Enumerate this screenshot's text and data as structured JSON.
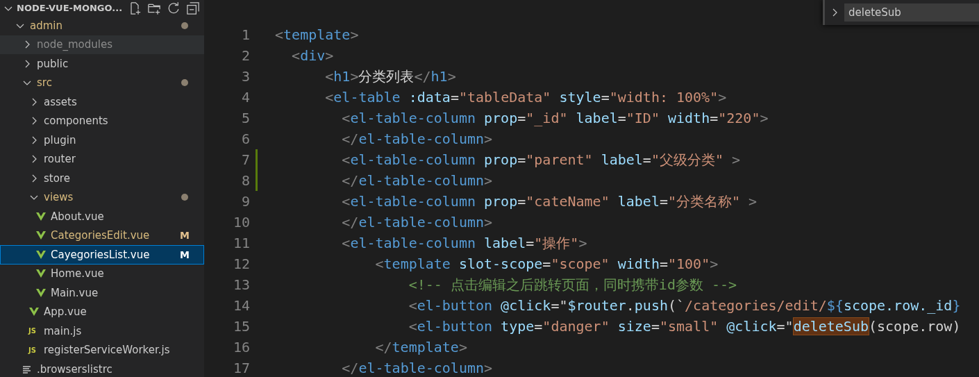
{
  "explorer": {
    "title": "NODE-VUE-MONGO...",
    "expanded": true,
    "tree": [
      {
        "name": "admin",
        "kind": "folder",
        "expanded": true,
        "modified": true,
        "selected": false,
        "children": [
          {
            "name": "node_modules",
            "kind": "folder",
            "expanded": false,
            "ignored": true,
            "selected": false,
            "hovered": true
          },
          {
            "name": "public",
            "kind": "folder",
            "expanded": false,
            "selected": false
          },
          {
            "name": "src",
            "kind": "folder",
            "expanded": true,
            "modified": true,
            "selected": false,
            "children": [
              {
                "name": "assets",
                "kind": "folder",
                "expanded": false,
                "selected": false
              },
              {
                "name": "components",
                "kind": "folder",
                "expanded": false,
                "selected": false
              },
              {
                "name": "plugin",
                "kind": "folder",
                "expanded": false,
                "selected": false
              },
              {
                "name": "router",
                "kind": "folder",
                "expanded": false,
                "selected": false
              },
              {
                "name": "store",
                "kind": "folder",
                "expanded": false,
                "selected": false
              },
              {
                "name": "views",
                "kind": "folder",
                "expanded": true,
                "modified": true,
                "selected": false,
                "children": [
                  {
                    "name": "About.vue",
                    "kind": "vue",
                    "selected": false
                  },
                  {
                    "name": "CategoriesEdit.vue",
                    "kind": "vue",
                    "modified": true,
                    "badge": "M",
                    "selected": false
                  },
                  {
                    "name": "CayegoriesList.vue",
                    "kind": "vue",
                    "modified": true,
                    "badge": "M",
                    "selected": true
                  },
                  {
                    "name": "Home.vue",
                    "kind": "vue",
                    "selected": false
                  },
                  {
                    "name": "Main.vue",
                    "kind": "vue",
                    "selected": false
                  }
                ]
              },
              {
                "name": "App.vue",
                "kind": "vue",
                "selected": false
              },
              {
                "name": "main.js",
                "kind": "js",
                "icon_text": "JS",
                "selected": false
              },
              {
                "name": "registerServiceWorker.js",
                "kind": "js",
                "icon_text": "JS",
                "selected": false
              }
            ]
          },
          {
            "name": ".browserslistrc",
            "kind": "config",
            "selected": false
          }
        ]
      }
    ]
  },
  "find_widget": {
    "value": "deleteSub"
  },
  "editor": {
    "lines": [
      {
        "number": "1",
        "changed": false,
        "tokens": [
          {
            "kind": "punct",
            "t": "<"
          },
          {
            "kind": "tag",
            "t": "template"
          },
          {
            "kind": "punct",
            "t": ">"
          }
        ]
      },
      {
        "number": "2",
        "changed": false,
        "tokens": [
          {
            "kind": "punct",
            "t": "  <"
          },
          {
            "kind": "tag",
            "t": "div"
          },
          {
            "kind": "punct",
            "t": ">"
          }
        ]
      },
      {
        "number": "3",
        "changed": false,
        "tokens": [
          {
            "kind": "punct",
            "t": "      <"
          },
          {
            "kind": "tag",
            "t": "h1"
          },
          {
            "kind": "punct",
            "t": ">"
          },
          {
            "kind": "text",
            "t": "分类列表"
          },
          {
            "kind": "punct",
            "t": "</"
          },
          {
            "kind": "tag",
            "t": "h1"
          },
          {
            "kind": "punct",
            "t": ">"
          }
        ]
      },
      {
        "number": "4",
        "changed": false,
        "tokens": [
          {
            "kind": "punct",
            "t": "      <"
          },
          {
            "kind": "tag",
            "t": "el-table"
          },
          {
            "kind": "attr",
            "t": " :data"
          },
          {
            "kind": "text",
            "t": "="
          },
          {
            "kind": "string",
            "t": "\"tableData\""
          },
          {
            "kind": "attr",
            "t": " style"
          },
          {
            "kind": "text",
            "t": "="
          },
          {
            "kind": "string",
            "t": "\"width: 100%\""
          },
          {
            "kind": "punct",
            "t": ">"
          }
        ]
      },
      {
        "number": "5",
        "changed": false,
        "tokens": [
          {
            "kind": "punct",
            "t": "        <"
          },
          {
            "kind": "tag",
            "t": "el-table-column"
          },
          {
            "kind": "attr",
            "t": " prop"
          },
          {
            "kind": "text",
            "t": "="
          },
          {
            "kind": "string",
            "t": "\"_id\""
          },
          {
            "kind": "attr",
            "t": " label"
          },
          {
            "kind": "text",
            "t": "="
          },
          {
            "kind": "string",
            "t": "\"ID\""
          },
          {
            "kind": "attr",
            "t": " width"
          },
          {
            "kind": "text",
            "t": "="
          },
          {
            "kind": "string",
            "t": "\"220\""
          },
          {
            "kind": "punct",
            "t": ">"
          }
        ]
      },
      {
        "number": "6",
        "changed": false,
        "tokens": [
          {
            "kind": "punct",
            "t": "        </"
          },
          {
            "kind": "tag",
            "t": "el-table-column"
          },
          {
            "kind": "punct",
            "t": ">"
          }
        ]
      },
      {
        "number": "7",
        "changed": true,
        "tokens": [
          {
            "kind": "punct",
            "t": "        <"
          },
          {
            "kind": "tag",
            "t": "el-table-column"
          },
          {
            "kind": "attr",
            "t": " prop"
          },
          {
            "kind": "text",
            "t": "="
          },
          {
            "kind": "string",
            "t": "\"parent\""
          },
          {
            "kind": "attr",
            "t": " label"
          },
          {
            "kind": "text",
            "t": "="
          },
          {
            "kind": "string",
            "t": "\"父级分类\""
          },
          {
            "kind": "punct",
            "t": " >"
          }
        ]
      },
      {
        "number": "8",
        "changed": true,
        "tokens": [
          {
            "kind": "punct",
            "t": "        </"
          },
          {
            "kind": "tag",
            "t": "el-table-column"
          },
          {
            "kind": "punct",
            "t": ">"
          }
        ]
      },
      {
        "number": "9",
        "changed": false,
        "tokens": [
          {
            "kind": "punct",
            "t": "        <"
          },
          {
            "kind": "tag",
            "t": "el-table-column"
          },
          {
            "kind": "attr",
            "t": " prop"
          },
          {
            "kind": "text",
            "t": "="
          },
          {
            "kind": "string",
            "t": "\"cateName\""
          },
          {
            "kind": "attr",
            "t": " label"
          },
          {
            "kind": "text",
            "t": "="
          },
          {
            "kind": "string",
            "t": "\"分类名称\""
          },
          {
            "kind": "punct",
            "t": " >"
          }
        ]
      },
      {
        "number": "10",
        "changed": false,
        "tokens": [
          {
            "kind": "punct",
            "t": "        </"
          },
          {
            "kind": "tag",
            "t": "el-table-column"
          },
          {
            "kind": "punct",
            "t": ">"
          }
        ]
      },
      {
        "number": "11",
        "changed": false,
        "tokens": [
          {
            "kind": "punct",
            "t": "        <"
          },
          {
            "kind": "tag",
            "t": "el-table-column"
          },
          {
            "kind": "attr",
            "t": " label"
          },
          {
            "kind": "text",
            "t": "="
          },
          {
            "kind": "string",
            "t": "\"操作\""
          },
          {
            "kind": "punct",
            "t": ">"
          }
        ]
      },
      {
        "number": "12",
        "changed": false,
        "tokens": [
          {
            "kind": "punct",
            "t": "            <"
          },
          {
            "kind": "tag",
            "t": "template"
          },
          {
            "kind": "attr",
            "t": " slot-scope"
          },
          {
            "kind": "text",
            "t": "="
          },
          {
            "kind": "string",
            "t": "\"scope\""
          },
          {
            "kind": "attr",
            "t": " width"
          },
          {
            "kind": "text",
            "t": "="
          },
          {
            "kind": "string",
            "t": "\"100\""
          },
          {
            "kind": "punct",
            "t": ">"
          }
        ]
      },
      {
        "number": "13",
        "changed": false,
        "tokens": [
          {
            "kind": "comment",
            "t": "                <!-- 点击编辑之后跳转页面，同时携带id参数 -->"
          }
        ]
      },
      {
        "number": "14",
        "changed": false,
        "tokens": [
          {
            "kind": "punct",
            "t": "                <"
          },
          {
            "kind": "tag",
            "t": "el-button"
          },
          {
            "kind": "attr",
            "t": " @click"
          },
          {
            "kind": "text",
            "t": "=\""
          },
          {
            "kind": "attr",
            "t": "$router"
          },
          {
            "kind": "text",
            "t": "."
          },
          {
            "kind": "attr",
            "t": "push"
          },
          {
            "kind": "text",
            "t": "(`"
          },
          {
            "kind": "string",
            "t": "/categories/edit/"
          },
          {
            "kind": "tag",
            "t": "${"
          },
          {
            "kind": "attr",
            "t": "scope.row._id"
          },
          {
            "kind": "tag",
            "t": "}"
          }
        ]
      },
      {
        "number": "15",
        "changed": false,
        "tokens": [
          {
            "kind": "punct",
            "t": "                <"
          },
          {
            "kind": "tag",
            "t": "el-button"
          },
          {
            "kind": "attr",
            "t": " type"
          },
          {
            "kind": "text",
            "t": "="
          },
          {
            "kind": "string",
            "t": "\"danger\""
          },
          {
            "kind": "attr",
            "t": " size"
          },
          {
            "kind": "text",
            "t": "="
          },
          {
            "kind": "string",
            "t": "\"small\""
          },
          {
            "kind": "attr",
            "t": " @click"
          },
          {
            "kind": "text",
            "t": "=\""
          },
          {
            "kind": "attr",
            "t": "deleteSub",
            "match": true
          },
          {
            "kind": "text",
            "t": "(scope.row)"
          }
        ]
      },
      {
        "number": "16",
        "changed": false,
        "tokens": [
          {
            "kind": "punct",
            "t": "            </"
          },
          {
            "kind": "tag",
            "t": "template"
          },
          {
            "kind": "punct",
            "t": ">"
          }
        ]
      },
      {
        "number": "17",
        "changed": false,
        "tokens": [
          {
            "kind": "punct",
            "t": "        </"
          },
          {
            "kind": "tag",
            "t": "el-table-column"
          },
          {
            "kind": "punct",
            "t": ">"
          }
        ]
      }
    ]
  }
}
